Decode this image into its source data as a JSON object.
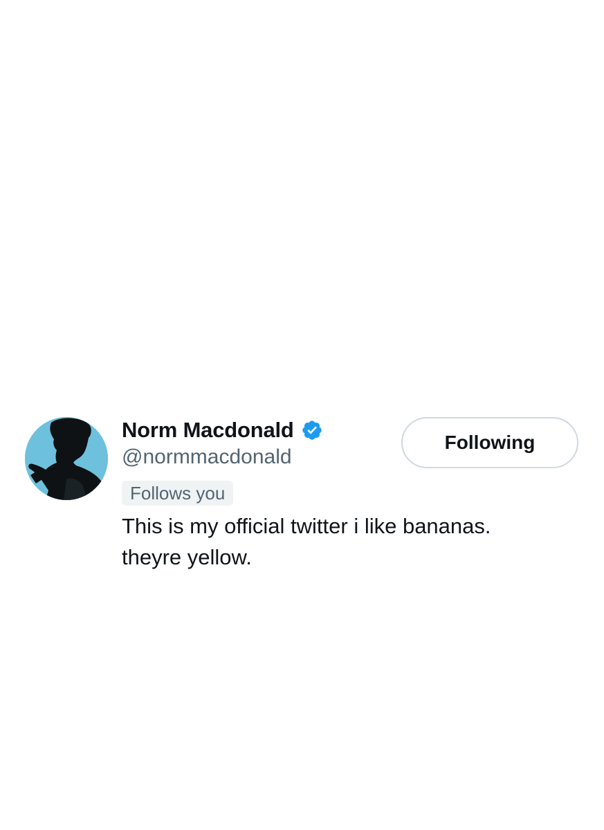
{
  "profile": {
    "display_name": "Norm Macdonald",
    "handle": "@normmacdonald",
    "verified_icon": "verified-badge-icon",
    "follows_you_label": "Follows you",
    "bio_lines": [
      "This is my official twitter i like bananas.",
      "theyre yellow."
    ],
    "avatar": "silhouette-avatar"
  },
  "actions": {
    "follow_button_label": "Following"
  },
  "colors": {
    "primary_text": "#0f1419",
    "secondary_text": "#536471",
    "verified_blue": "#1d9bf0",
    "badge_bg": "#eff3f4",
    "button_border": "#cfd9de",
    "avatar_bg": "#6ec1dc"
  }
}
